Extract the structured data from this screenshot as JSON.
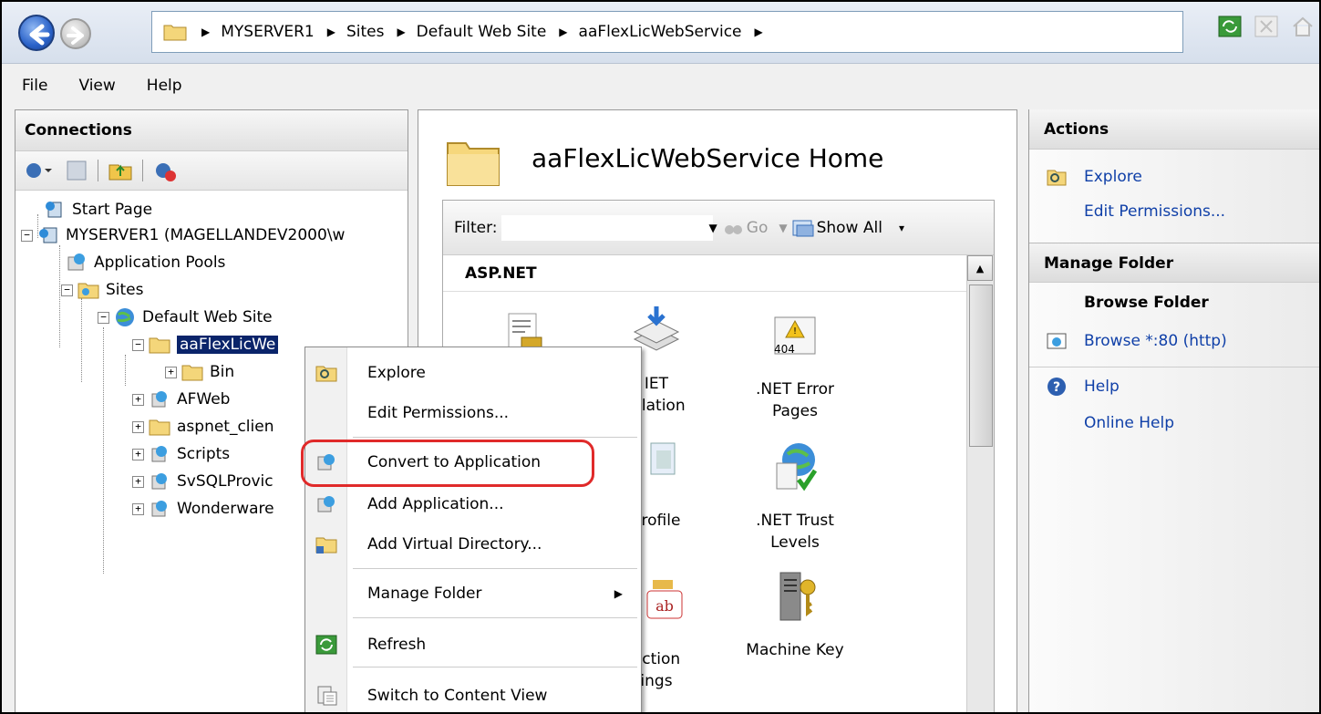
{
  "breadcrumb": [
    "MYSERVER1",
    "Sites",
    "Default Web Site",
    "aaFlexLicWebService"
  ],
  "menu": [
    "File",
    "View",
    "Help"
  ],
  "connections": {
    "title": "Connections",
    "tree": {
      "start_page": "Start Page",
      "server": "MYSERVER1 (MAGELLANDEV2000\\w",
      "app_pools": "Application Pools",
      "sites": "Sites",
      "default_site": "Default Web Site",
      "selected": "aaFlexLicWe",
      "bin": "Bin",
      "afweb": "AFWeb",
      "aspnet": "aspnet_clien",
      "scripts": "Scripts",
      "svsql": "SvSQLProvic",
      "wonderware": "Wonderware"
    }
  },
  "main": {
    "title": "aaFlexLicWebService Home",
    "filter_label": "Filter:",
    "go_label": "Go",
    "show_all_label": "Show All",
    "group": "ASP.NET",
    "features": [
      {
        "line1": "",
        "line2": ""
      },
      {
        "line1": "IET",
        "line2": "pilation"
      },
      {
        "line1": ".NET Error",
        "line2": "Pages"
      },
      {
        "line1": "",
        "line2": ""
      },
      {
        "line1": "Profile",
        "line2": ""
      },
      {
        "line1": ".NET Trust",
        "line2": "Levels"
      },
      {
        "line1": "ection",
        "line2": "ings"
      },
      {
        "line1": "Machine Key",
        "line2": ""
      }
    ],
    "error_badge": "404",
    "ab_badge": "ab"
  },
  "actions": {
    "title": "Actions",
    "explore": "Explore",
    "edit_permissions": "Edit Permissions...",
    "manage_folder": "Manage Folder",
    "browse_folder": "Browse Folder",
    "browse_80": "Browse *:80 (http)",
    "help": "Help",
    "online_help": "Online Help"
  },
  "context_menu": {
    "explore": "Explore",
    "edit_permissions": "Edit Permissions...",
    "convert": "Convert to Application",
    "add_application": "Add Application...",
    "add_vdir": "Add Virtual Directory...",
    "manage_folder": "Manage Folder",
    "refresh": "Refresh",
    "switch_content": "Switch to Content View"
  },
  "colors": {
    "selection": "#0a246a",
    "link": "#1040a8",
    "highlight": "#e02a2a"
  }
}
